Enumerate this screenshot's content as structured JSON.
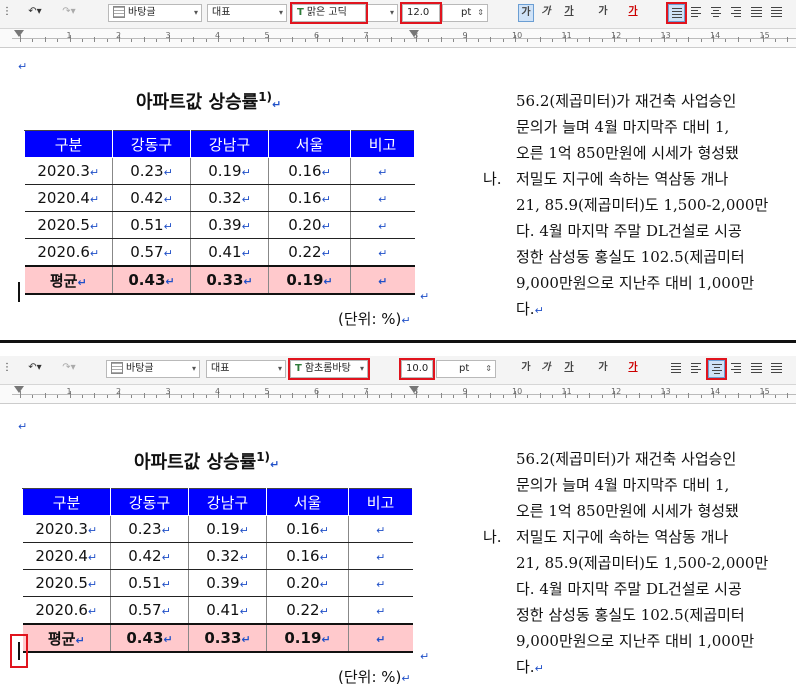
{
  "panels": [
    {
      "toolbar": {
        "style": "바탕글",
        "lang": "대표",
        "font": "맑은 고딕",
        "size": "12.0",
        "unit": "pt",
        "format_buttons": [
          "가",
          "가",
          "가",
          "가",
          "가"
        ],
        "active_align": "justify"
      }
    },
    {
      "toolbar": {
        "style": "바탕글",
        "lang": "대표",
        "font": "함초롬바탕",
        "size": "10.0",
        "unit": "pt",
        "format_buttons": [
          "가",
          "가",
          "가",
          "가",
          "가"
        ],
        "active_align": "center"
      }
    }
  ],
  "ruler_numbers": [
    "1",
    "2",
    "3",
    "4",
    "5",
    "6",
    "7",
    "8",
    "9",
    "10",
    "11",
    "12",
    "13",
    "14",
    "15"
  ],
  "document": {
    "title": "아파트값 상승률",
    "title_note": "1)",
    "table": {
      "headers": [
        "구분",
        "강동구",
        "강남구",
        "서울",
        "비고"
      ],
      "rows": [
        [
          "2020.3",
          "0.23",
          "0.19",
          "0.16",
          ""
        ],
        [
          "2020.4",
          "0.42",
          "0.32",
          "0.16",
          ""
        ],
        [
          "2020.5",
          "0.51",
          "0.39",
          "0.20",
          ""
        ],
        [
          "2020.6",
          "0.57",
          "0.41",
          "0.22",
          ""
        ]
      ],
      "average_row": [
        "평균",
        "0.43",
        "0.33",
        "0.19",
        ""
      ]
    },
    "unit_note": "(단위: %)",
    "paragraph": {
      "lines_before": [
        "56.2(제곱미터)가 재건축 사업승인",
        "문의가 늘며 4월 마지막주 대비 1,",
        "오른 1억 850만원에 시세가 형성됐"
      ],
      "marker": "나.",
      "lines_after": [
        "저밀도 지구에 속하는 역삼동 개나",
        "21, 85.9(제곱미터)도 1,500-2,000만",
        "다. 4월 마지막 주말 DL건설로 시공",
        "정한 삼성동 홍실도 102.5(제곱미터",
        "9,000만원으로 지난주 대비 1,000만",
        "다."
      ]
    }
  },
  "colors": {
    "header_bg": "#0000ff",
    "average_bg": "#ffc9cc",
    "highlight": "#e0141e",
    "para_mark": "#2050c8"
  }
}
